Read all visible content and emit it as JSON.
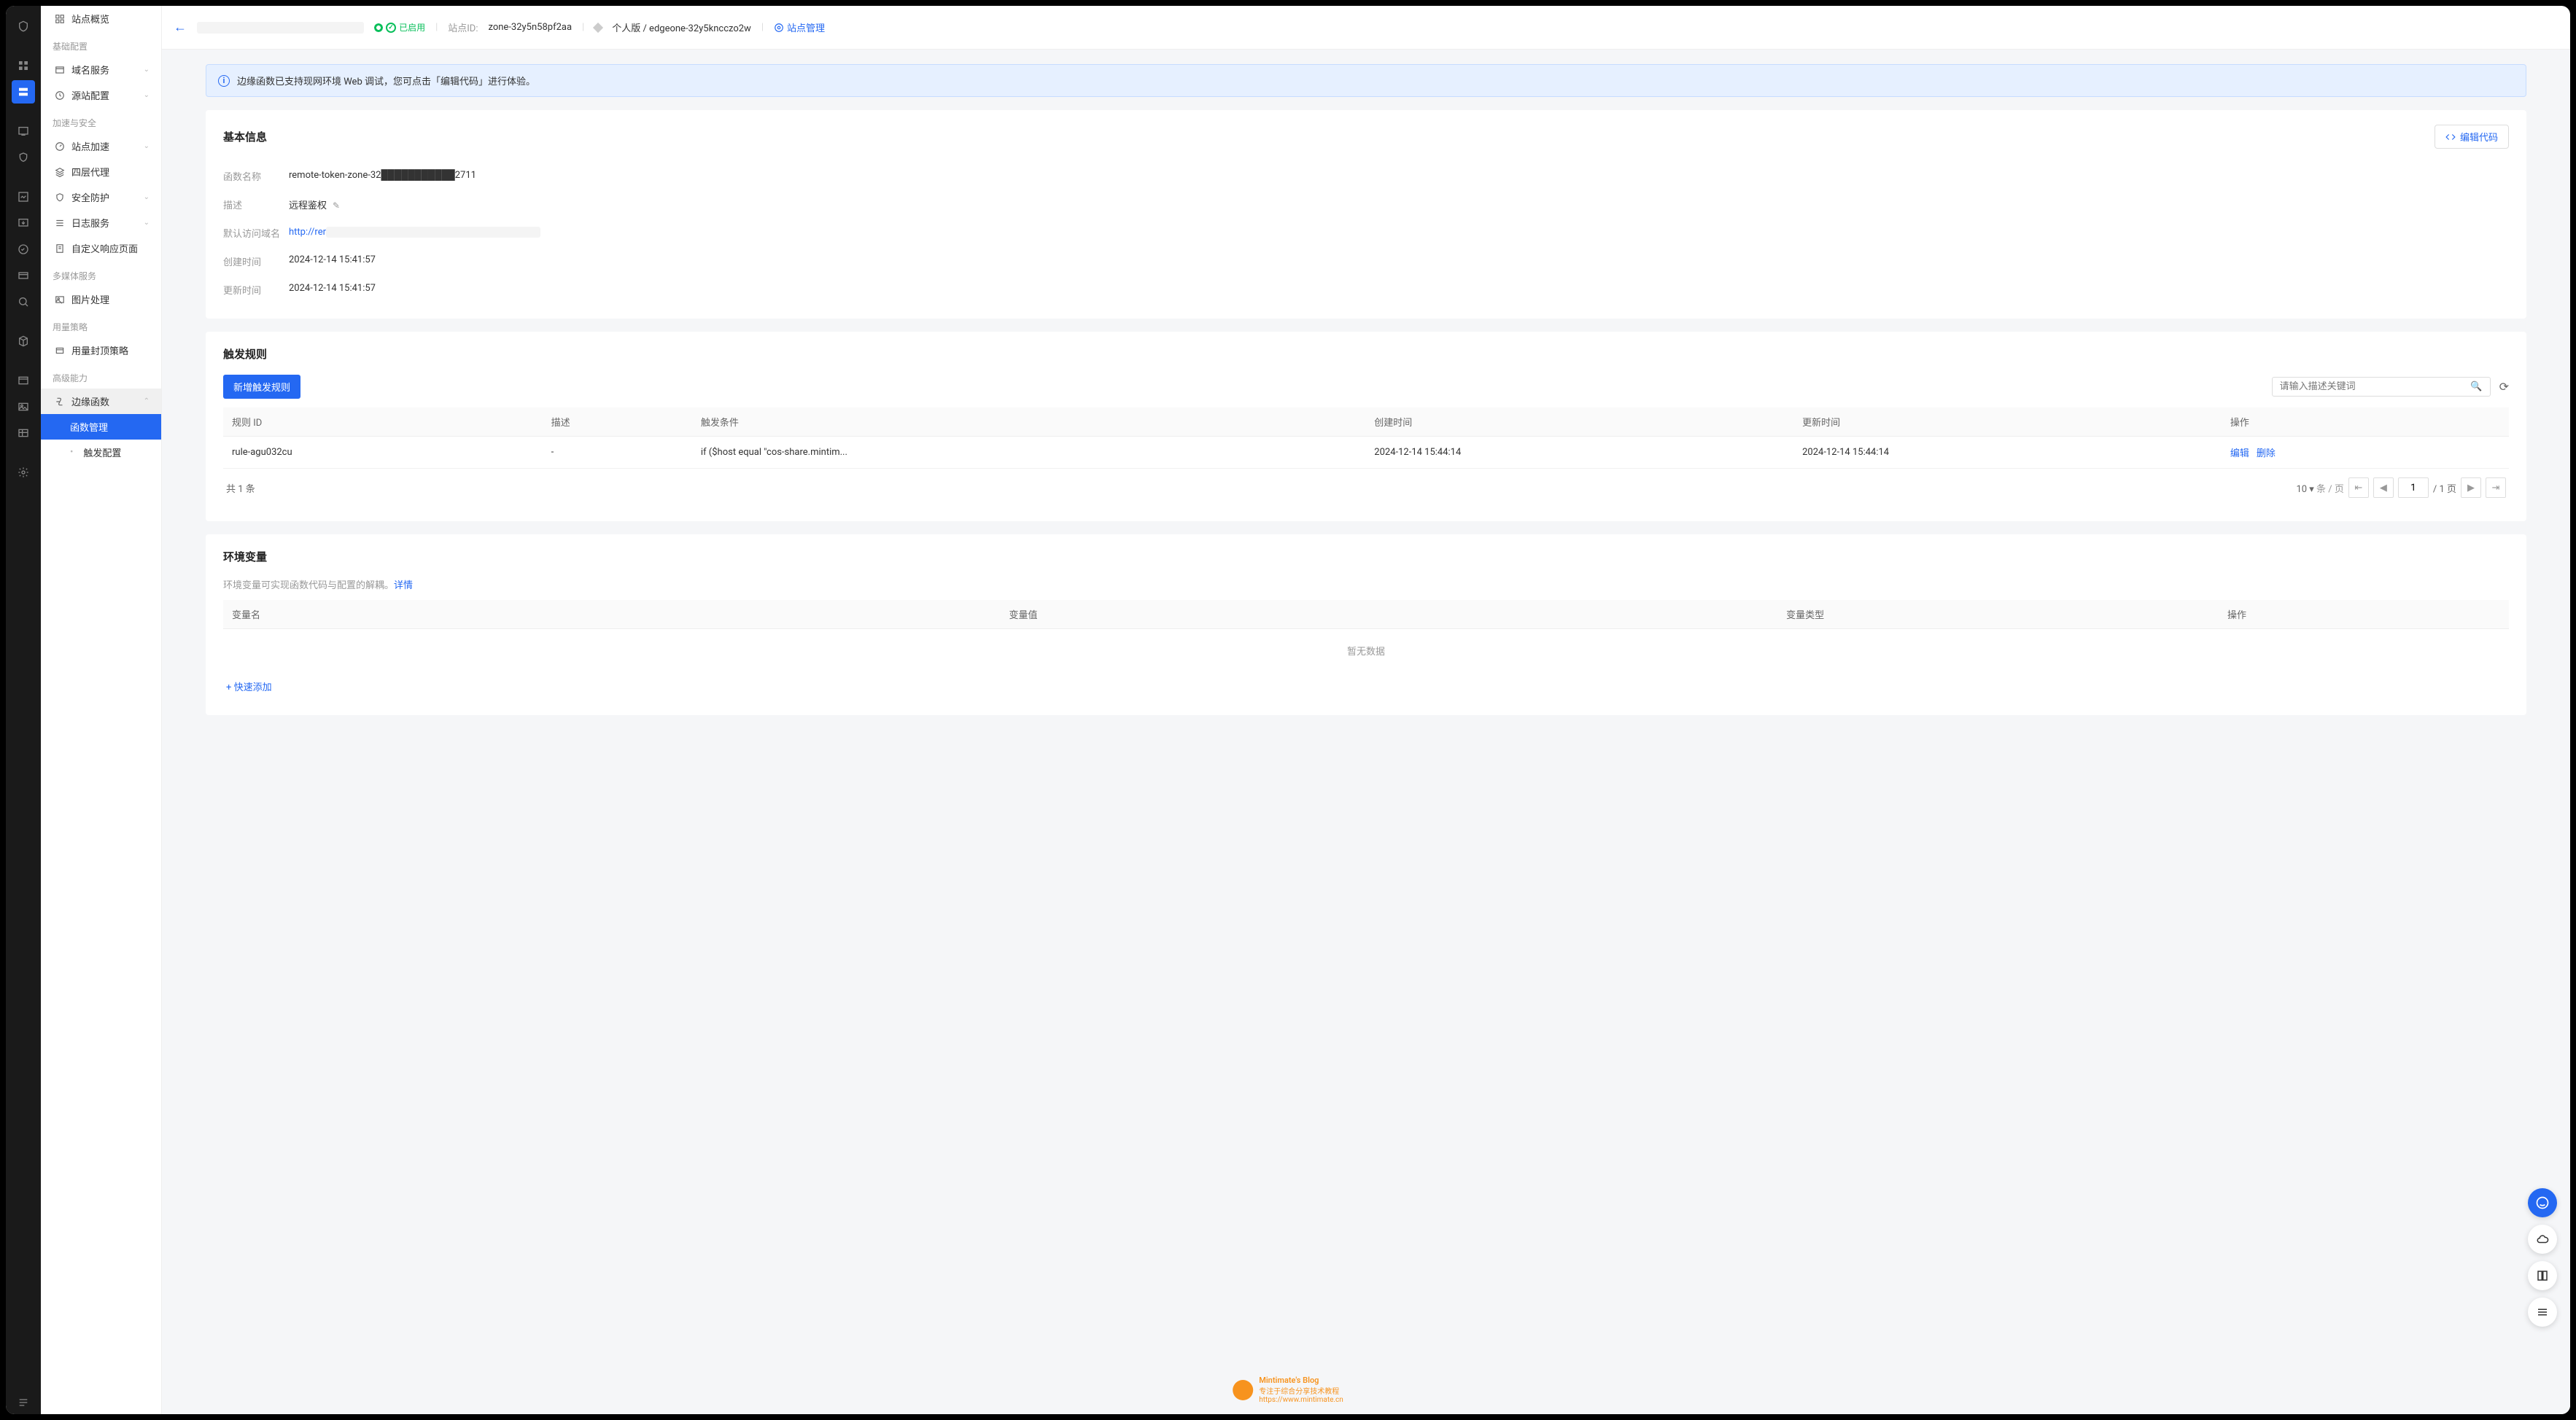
{
  "topbar": {
    "status": "已启用",
    "site_id_label": "站点ID:",
    "site_id": "zone-32y5n58pf2aa",
    "plan": "个人版 / edgeone-32y5kncczo2w",
    "manage_link": "站点管理"
  },
  "sidebar": {
    "overview": "站点概览",
    "groups": [
      {
        "title": "基础配置",
        "items": [
          {
            "label": "域名服务",
            "icon": "globe",
            "expand": true
          },
          {
            "label": "源站配置",
            "icon": "clock",
            "expand": true
          }
        ]
      },
      {
        "title": "加速与安全",
        "items": [
          {
            "label": "站点加速",
            "icon": "speed",
            "expand": true
          },
          {
            "label": "四层代理",
            "icon": "layers"
          },
          {
            "label": "安全防护",
            "icon": "shield",
            "expand": true
          },
          {
            "label": "日志服务",
            "icon": "list",
            "expand": true
          },
          {
            "label": "自定义响应页面",
            "icon": "page"
          }
        ]
      },
      {
        "title": "多媒体服务",
        "items": [
          {
            "label": "图片处理",
            "icon": "image"
          }
        ]
      },
      {
        "title": "用量策略",
        "items": [
          {
            "label": "用量封顶策略",
            "icon": "cap"
          }
        ]
      },
      {
        "title": "高级能力",
        "items": [
          {
            "label": "边缘函数",
            "icon": "fx",
            "expand": true,
            "highlighted": true
          }
        ]
      }
    ],
    "sub_items": [
      {
        "label": "函数管理",
        "selected": true
      },
      {
        "label": "触发配置"
      }
    ]
  },
  "alert": "边缘函数已支持现网环境 Web 调试，您可点击「编辑代码」进行体验。",
  "basic": {
    "title": "基本信息",
    "edit_button": "编辑代码",
    "rows": {
      "name_label": "函数名称",
      "name_value": "remote-token-zone-32███████████2711",
      "desc_label": "描述",
      "desc_value": "远程鉴权",
      "domain_label": "默认访问域名",
      "domain_value": "http://rer",
      "created_label": "创建时间",
      "created_value": "2024-12-14 15:41:57",
      "updated_label": "更新时间",
      "updated_value": "2024-12-14 15:41:57"
    }
  },
  "rules": {
    "title": "触发规则",
    "add_button": "新增触发规则",
    "search_placeholder": "请输入描述关键词",
    "headers": {
      "id": "规则 ID",
      "desc": "描述",
      "cond": "触发条件",
      "created": "创建时间",
      "updated": "更新时间",
      "ops": "操作"
    },
    "row": {
      "id": "rule-agu032cu",
      "desc": "-",
      "cond": "if ($host equal \"cos-share.mintim...",
      "created": "2024-12-14 15:44:14",
      "updated": "2024-12-14 15:44:14"
    },
    "ops": {
      "edit": "编辑",
      "delete": "删除"
    },
    "pager": {
      "total_prefix": "共",
      "total_count": "1",
      "total_suffix": "条",
      "page_size": "10",
      "page_unit": "条 / 页",
      "current": "1",
      "pages": "/ 1 页"
    }
  },
  "env": {
    "title": "环境变量",
    "hint": "环境变量可实现函数代码与配置的解耦。",
    "hint_link": "详情",
    "headers": {
      "name": "变量名",
      "value": "变量值",
      "type": "变量类型",
      "ops": "操作"
    },
    "empty": "暂无数据",
    "add": "+ 快速添加"
  },
  "watermark": {
    "l1": "Mintimate's Blog",
    "l2": "专注于综合分享技术教程",
    "l3": "https://www.mintimate.cn"
  }
}
